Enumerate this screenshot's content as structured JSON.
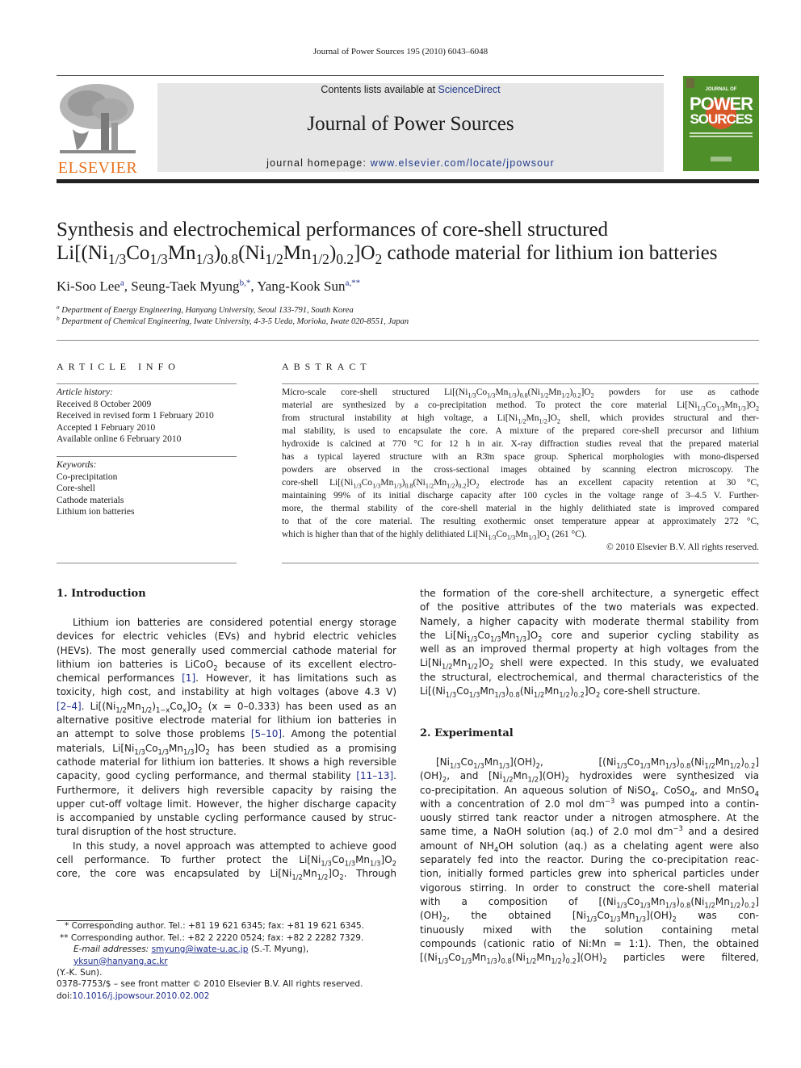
{
  "running_header": "Journal of Power Sources 195 (2010) 6043–6048",
  "masthead": {
    "contents_prefix": "Contents lists available at ",
    "contents_link": "ScienceDirect",
    "journal_title": "Journal of Power Sources",
    "homepage_prefix": "journal homepage: ",
    "homepage_link": "www.elsevier.com/locate/jpowsour",
    "publisher_logo_text": "ELSEVIER",
    "cover_line1": "JOURNAL OF",
    "cover_line2": "POWER",
    "cover_line3": "SOURCES"
  },
  "article": {
    "title_line1": "Synthesis and electrochemical performances of core-shell structured",
    "title_line2": "Li[(Ni_{1/3}Co_{1/3}Mn_{1/3})_{0.8}(Ni_{1/2}Mn_{1/2})_{0.2}]O_{2} cathode material for lithium ion batteries",
    "authors": [
      {
        "name": "Ki-Soo Lee",
        "marks": "a"
      },
      {
        "name": "Seung-Taek Myung",
        "marks": "b,*"
      },
      {
        "name": "Yang-Kook Sun",
        "marks": "a,**"
      }
    ],
    "affiliations": [
      {
        "mark": "a",
        "text": "Department of Energy Engineering, Hanyang University, Seoul 133-791, South Korea"
      },
      {
        "mark": "b",
        "text": "Department of Chemical Engineering, Iwate University, 4-3-5 Ueda, Morioka, Iwate 020-8551, Japan"
      }
    ]
  },
  "article_info": {
    "heading": "ARTICLE INFO",
    "history_label": "Article history:",
    "history": [
      "Received 8 October 2009",
      "Received in revised form 1 February 2010",
      "Accepted 1 February 2010",
      "Available online 6 February 2010"
    ],
    "keywords_label": "Keywords:",
    "keywords": [
      "Co-precipitation",
      "Core-shell",
      "Cathode materials",
      "Lithium ion batteries"
    ]
  },
  "abstract": {
    "heading": "ABSTRACT",
    "lines": [
      "Micro-scale core-shell structured Li[(Ni_{1/3}Co_{1/3}Mn_{1/3})_{0.8}(Ni_{1/2}Mn_{1/2})_{0.2}]O_{2} powders for use as cathode",
      "material are synthesized by a co-precipitation method. To protect the core material Li[Ni_{1/3}Co_{1/3}Mn_{1/3}]O_{2}",
      "from structural instability at high voltage, a Li[Ni_{1/2}Mn_{1/2}]O_{2} shell, which provides structural and ther-",
      "mal stability, is used to encapsulate the core. A mixture of the prepared core-shell precursor and lithium",
      "hydroxide is calcined at 770 °C for 12 h in air. X-ray diffraction studies reveal that the prepared material",
      "has a typical layered structure with an R3̄m space group. Spherical morphologies with mono-dispersed",
      "powders are observed in the cross-sectional images obtained by scanning electron microscopy. The",
      "core-shell Li[(Ni_{1/3}Co_{1/3}Mn_{1/3})_{0.8}(Ni_{1/2}Mn_{1/2})_{0.2}]O_{2} electrode has an excellent capacity retention at 30 °C,",
      "maintaining 99% of its initial discharge capacity after 100 cycles in the voltage range of 3–4.5 V. Further-",
      "more, the thermal stability of the core-shell material in the highly delithiated state is improved compared",
      "to that of the core material. The resulting exothermic onset temperature appear at approximately 272 °C,",
      "which is higher than that of the highly delithiated Li[Ni_{1/3}Co_{1/3}Mn_{1/3}]O_{2} (261 °C)."
    ],
    "copyright": "© 2010 Elsevier B.V. All rights reserved."
  },
  "sections": {
    "intro_heading": "1.  Introduction",
    "intro_lines": [
      "Lithium ion batteries are considered potential energy storage",
      "devices for electric vehicles (EVs) and hybrid electric vehicles",
      "(HEVs). The most generally used commercial cathode material for",
      "lithium ion batteries is LiCoO_{2} because of its excellent electro-",
      "chemical performances [[1]]. However, it has limitations such as",
      "toxicity, high cost, and instability at high voltages (above 4.3 V)",
      "[[2–4]]. Li[(Ni_{1/2}Mn_{1/2})_{1−x}Co_{x}]O_{2} (x = 0–0.333) has been used as an",
      "alternative positive electrode material for lithium ion batteries in",
      "an attempt to solve those problems [[5–10]]. Among the potential",
      "materials, Li[Ni_{1/3}Co_{1/3}Mn_{1/3}]O_{2} has been studied as a promising",
      "cathode material for lithium ion batteries. It shows a high reversible",
      "capacity, good cycling performance, and thermal stability [[11–13]].",
      "Furthermore, it delivers high reversible capacity by raising the",
      "upper cut-off voltage limit. However, the higher discharge capacity",
      "is accompanied by unstable cycling performance caused by struc-",
      "tural disruption of the host structure.",
      "In this study, a novel approach was attempted to achieve good",
      "cell performance. To further protect the Li[Ni_{1/3}Co_{1/3}Mn_{1/3}]O_{2}",
      "core, the core was encapsulated by Li[Ni_{1/2}Mn_{1/2}]O_{2}. Through"
    ],
    "right_intro_lines": [
      "the formation of the core-shell architecture, a synergetic effect",
      "of the positive attributes of the two materials was expected.",
      "Namely, a higher capacity with moderate thermal stability from",
      "the Li[Ni_{1/3}Co_{1/3}Mn_{1/3}]O_{2} core and superior cycling stability as",
      "well as an improved thermal property at high voltages from the",
      "Li[Ni_{1/2}Mn_{1/2}]O_{2} shell were expected. In this study, we evaluated",
      "the structural, electrochemical, and thermal characteristics of the",
      "Li[(Ni_{1/3}Co_{1/3}Mn_{1/3})_{0.8}(Ni_{1/2}Mn_{1/2})_{0.2}]O_{2} core-shell structure."
    ],
    "exp_heading": "2.  Experimental",
    "exp_lines": [
      "[Ni_{1/3}Co_{1/3}Mn_{1/3}](OH)_{2},   [(Ni_{1/3}Co_{1/3}Mn_{1/3})_{0.8}(Ni_{1/2}Mn_{1/2})_{0.2}]",
      "(OH)_{2}, and [Ni_{1/2}Mn_{1/2}](OH)_{2} hydroxides were synthesized via",
      "co-precipitation. An aqueous solution of NiSO_{4}, CoSO_{4}, and MnSO_{4}",
      "with a concentration of 2.0 mol dm^{−3} was pumped into a contin-",
      "uously stirred tank reactor under a nitrogen atmosphere. At the",
      "same time, a NaOH solution (aq.) of 2.0 mol dm^{−3} and a desired",
      "amount of NH_{4}OH solution (aq.) as a chelating agent were also",
      "separately fed into the reactor. During the co-precipitation reac-",
      "tion, initially formed particles grew into spherical particles under",
      "vigorous stirring. In order to construct the core-shell material",
      "with a composition of [(Ni_{1/3}Co_{1/3}Mn_{1/3})_{0.8}(Ni_{1/2}Mn_{1/2})_{0.2}]",
      "(OH)_{2}, the obtained [Ni_{1/3}Co_{1/3}Mn_{1/3}](OH)_{2} was con-",
      "tinuously mixed with the solution containing metal",
      "compounds (cationic ratio of Ni:Mn = 1:1). Then, the obtained",
      "[(Ni_{1/3}Co_{1/3}Mn_{1/3})_{0.8}(Ni_{1/2}Mn_{1/2})_{0.2}](OH)_{2} particles were filtered,"
    ]
  },
  "footnotes": {
    "corr1": "* Corresponding author. Tel.: +81 19 621 6345; fax: +81 19 621 6345.",
    "corr2": "** Corresponding author. Tel.: +82 2 2220 0524; fax: +82 2 2282 7329.",
    "email_label": "E-mail addresses:",
    "email1": "smyung@iwate-u.ac.jp",
    "email1_owner": " (S.-T. Myung), ",
    "email2": "yksun@hanyang.ac.kr",
    "email2_owner": "(Y.-K. Sun).",
    "issn": "0378-7753/$ – see front matter © 2010 Elsevier B.V. All rights reserved.",
    "doi_prefix": "doi:",
    "doi": "10.1016/j.jpowsour.2010.02.002"
  }
}
